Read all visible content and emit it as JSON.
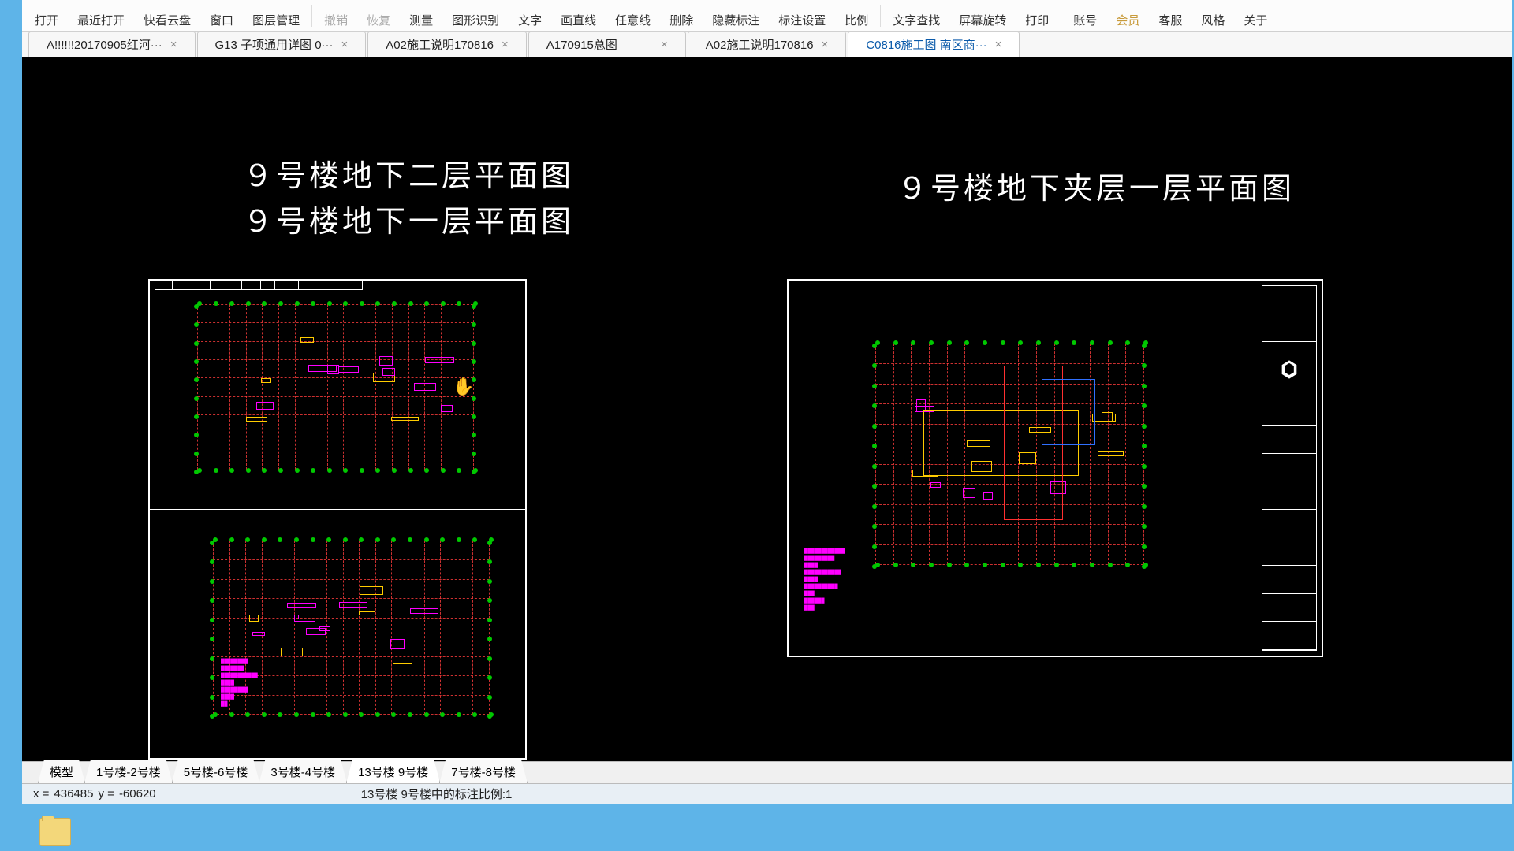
{
  "toolbar": {
    "open": "打开",
    "recent": "最近打开",
    "cloud": "快看云盘",
    "window": "窗口",
    "layer": "图层管理",
    "undo": "撤销",
    "redo": "恢复",
    "measure": "测量",
    "recognize": "图形识别",
    "text": "文字",
    "drawline": "画直线",
    "anyline": "任意线",
    "delete": "删除",
    "hidemark": "隐藏标注",
    "markset": "标注设置",
    "ratio": "比例",
    "textfind": "文字查找",
    "rotate": "屏幕旋转",
    "print": "打印",
    "account": "账号",
    "member": "会员",
    "support": "客服",
    "style": "风格",
    "about": "关于"
  },
  "tabs": [
    {
      "label": "A!!!!!!20170905红河···",
      "active": false
    },
    {
      "label": "G13 子项通用详图   0···",
      "active": false
    },
    {
      "label": "A02施工说明170816",
      "active": false
    },
    {
      "label": "A170915总图",
      "active": false
    },
    {
      "label": "A02施工说明170816",
      "active": false
    },
    {
      "label": "C0816施工图  南区商···",
      "active": true
    }
  ],
  "drawing_titles": {
    "t1": "９号楼地下二层平面图",
    "t2": "９号楼地下一层平面图",
    "t3": "９号楼地下夹层一层平面图"
  },
  "sheet_tabs": [
    {
      "label": "模型",
      "active": false
    },
    {
      "label": "1号楼-2号楼",
      "active": false
    },
    {
      "label": "5号楼-6号楼",
      "active": false
    },
    {
      "label": "3号楼-4号楼",
      "active": false
    },
    {
      "label": "13号楼 9号楼",
      "active": true
    },
    {
      "label": "7号楼-8号楼",
      "active": false
    }
  ],
  "status": {
    "x_label": "x =",
    "x_value": "436485",
    "y_label": "y =",
    "y_value": "-60620",
    "ratio_text": "13号楼 9号楼中的标注比例:1"
  }
}
